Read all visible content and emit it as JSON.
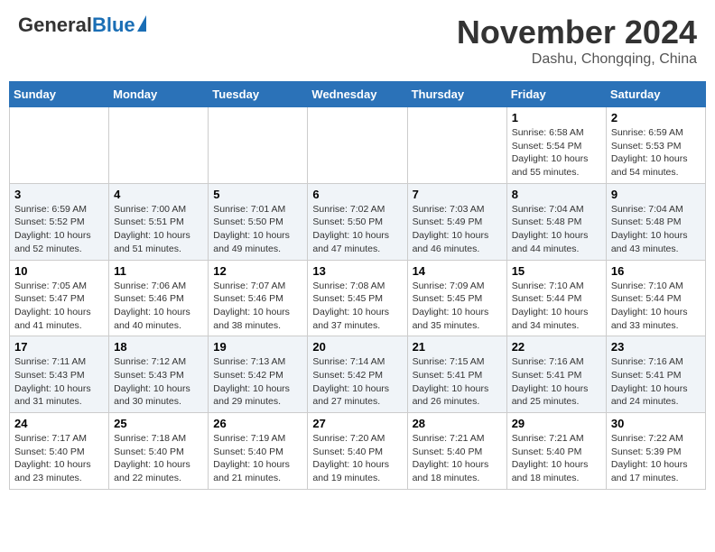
{
  "header": {
    "logo_general": "General",
    "logo_blue": "Blue",
    "month_title": "November 2024",
    "location": "Dashu, Chongqing, China"
  },
  "weekdays": [
    "Sunday",
    "Monday",
    "Tuesday",
    "Wednesday",
    "Thursday",
    "Friday",
    "Saturday"
  ],
  "weeks": [
    [
      {
        "day": "",
        "info": ""
      },
      {
        "day": "",
        "info": ""
      },
      {
        "day": "",
        "info": ""
      },
      {
        "day": "",
        "info": ""
      },
      {
        "day": "",
        "info": ""
      },
      {
        "day": "1",
        "info": "Sunrise: 6:58 AM\nSunset: 5:54 PM\nDaylight: 10 hours and 55 minutes."
      },
      {
        "day": "2",
        "info": "Sunrise: 6:59 AM\nSunset: 5:53 PM\nDaylight: 10 hours and 54 minutes."
      }
    ],
    [
      {
        "day": "3",
        "info": "Sunrise: 6:59 AM\nSunset: 5:52 PM\nDaylight: 10 hours and 52 minutes."
      },
      {
        "day": "4",
        "info": "Sunrise: 7:00 AM\nSunset: 5:51 PM\nDaylight: 10 hours and 51 minutes."
      },
      {
        "day": "5",
        "info": "Sunrise: 7:01 AM\nSunset: 5:50 PM\nDaylight: 10 hours and 49 minutes."
      },
      {
        "day": "6",
        "info": "Sunrise: 7:02 AM\nSunset: 5:50 PM\nDaylight: 10 hours and 47 minutes."
      },
      {
        "day": "7",
        "info": "Sunrise: 7:03 AM\nSunset: 5:49 PM\nDaylight: 10 hours and 46 minutes."
      },
      {
        "day": "8",
        "info": "Sunrise: 7:04 AM\nSunset: 5:48 PM\nDaylight: 10 hours and 44 minutes."
      },
      {
        "day": "9",
        "info": "Sunrise: 7:04 AM\nSunset: 5:48 PM\nDaylight: 10 hours and 43 minutes."
      }
    ],
    [
      {
        "day": "10",
        "info": "Sunrise: 7:05 AM\nSunset: 5:47 PM\nDaylight: 10 hours and 41 minutes."
      },
      {
        "day": "11",
        "info": "Sunrise: 7:06 AM\nSunset: 5:46 PM\nDaylight: 10 hours and 40 minutes."
      },
      {
        "day": "12",
        "info": "Sunrise: 7:07 AM\nSunset: 5:46 PM\nDaylight: 10 hours and 38 minutes."
      },
      {
        "day": "13",
        "info": "Sunrise: 7:08 AM\nSunset: 5:45 PM\nDaylight: 10 hours and 37 minutes."
      },
      {
        "day": "14",
        "info": "Sunrise: 7:09 AM\nSunset: 5:45 PM\nDaylight: 10 hours and 35 minutes."
      },
      {
        "day": "15",
        "info": "Sunrise: 7:10 AM\nSunset: 5:44 PM\nDaylight: 10 hours and 34 minutes."
      },
      {
        "day": "16",
        "info": "Sunrise: 7:10 AM\nSunset: 5:44 PM\nDaylight: 10 hours and 33 minutes."
      }
    ],
    [
      {
        "day": "17",
        "info": "Sunrise: 7:11 AM\nSunset: 5:43 PM\nDaylight: 10 hours and 31 minutes."
      },
      {
        "day": "18",
        "info": "Sunrise: 7:12 AM\nSunset: 5:43 PM\nDaylight: 10 hours and 30 minutes."
      },
      {
        "day": "19",
        "info": "Sunrise: 7:13 AM\nSunset: 5:42 PM\nDaylight: 10 hours and 29 minutes."
      },
      {
        "day": "20",
        "info": "Sunrise: 7:14 AM\nSunset: 5:42 PM\nDaylight: 10 hours and 27 minutes."
      },
      {
        "day": "21",
        "info": "Sunrise: 7:15 AM\nSunset: 5:41 PM\nDaylight: 10 hours and 26 minutes."
      },
      {
        "day": "22",
        "info": "Sunrise: 7:16 AM\nSunset: 5:41 PM\nDaylight: 10 hours and 25 minutes."
      },
      {
        "day": "23",
        "info": "Sunrise: 7:16 AM\nSunset: 5:41 PM\nDaylight: 10 hours and 24 minutes."
      }
    ],
    [
      {
        "day": "24",
        "info": "Sunrise: 7:17 AM\nSunset: 5:40 PM\nDaylight: 10 hours and 23 minutes."
      },
      {
        "day": "25",
        "info": "Sunrise: 7:18 AM\nSunset: 5:40 PM\nDaylight: 10 hours and 22 minutes."
      },
      {
        "day": "26",
        "info": "Sunrise: 7:19 AM\nSunset: 5:40 PM\nDaylight: 10 hours and 21 minutes."
      },
      {
        "day": "27",
        "info": "Sunrise: 7:20 AM\nSunset: 5:40 PM\nDaylight: 10 hours and 19 minutes."
      },
      {
        "day": "28",
        "info": "Sunrise: 7:21 AM\nSunset: 5:40 PM\nDaylight: 10 hours and 18 minutes."
      },
      {
        "day": "29",
        "info": "Sunrise: 7:21 AM\nSunset: 5:40 PM\nDaylight: 10 hours and 18 minutes."
      },
      {
        "day": "30",
        "info": "Sunrise: 7:22 AM\nSunset: 5:39 PM\nDaylight: 10 hours and 17 minutes."
      }
    ]
  ]
}
